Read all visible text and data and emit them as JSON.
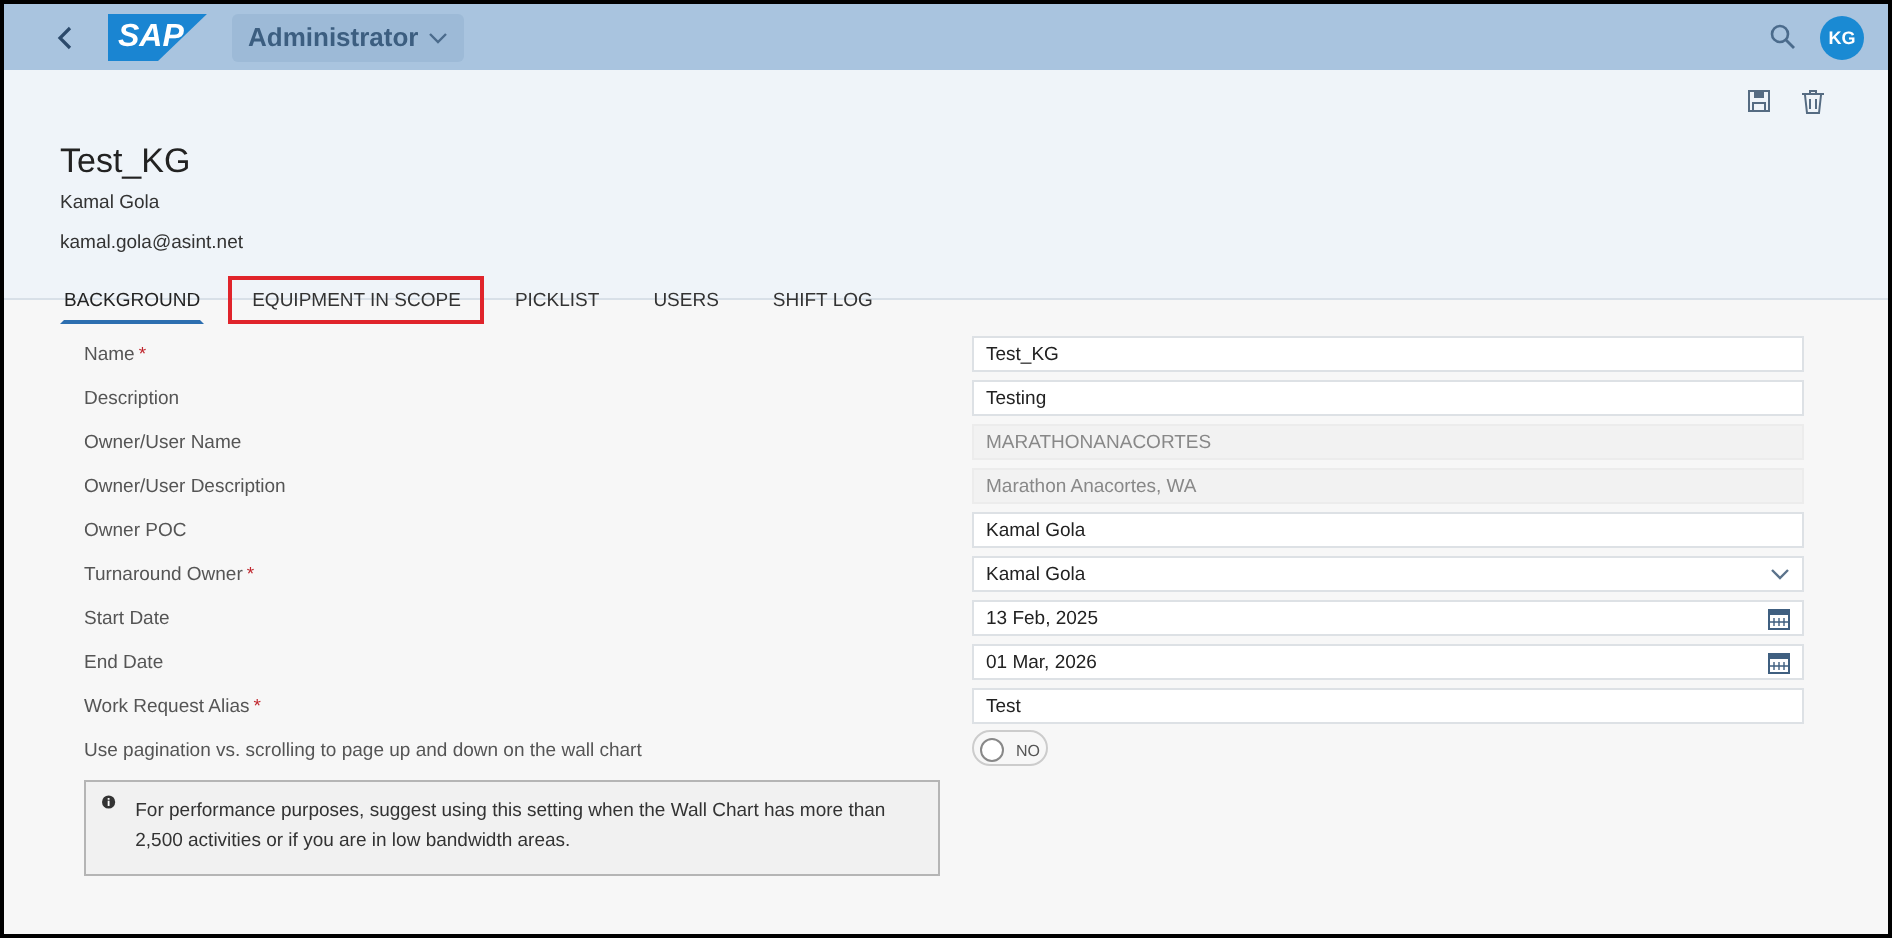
{
  "shell": {
    "logo": "SAP",
    "role": "Administrator",
    "avatar": "KG"
  },
  "header": {
    "title": "Test_KG",
    "subtitle": "Kamal Gola",
    "email": "kamal.gola@asint.net"
  },
  "tabs": [
    {
      "label": "BACKGROUND",
      "selected": true,
      "highlighted": false
    },
    {
      "label": "EQUIPMENT IN SCOPE",
      "selected": false,
      "highlighted": true
    },
    {
      "label": "PICKLIST",
      "selected": false,
      "highlighted": false
    },
    {
      "label": "USERS",
      "selected": false,
      "highlighted": false
    },
    {
      "label": "SHIFT LOG",
      "selected": false,
      "highlighted": false
    }
  ],
  "fields": [
    {
      "label": "Name",
      "required_mark": "*",
      "kind": "text",
      "value": "Test_KG"
    },
    {
      "label": "Description",
      "kind": "text",
      "value": "Testing"
    },
    {
      "label": "Owner/User Name",
      "kind": "readonly",
      "value": "MARATHONANACORTES"
    },
    {
      "label": "Owner/User Description",
      "kind": "readonly",
      "value": "Marathon Anacortes, WA"
    },
    {
      "label": "Owner POC",
      "kind": "text",
      "value": "Kamal Gola"
    },
    {
      "label": "Turnaround Owner",
      "required_mark": "*",
      "kind": "select",
      "value": "Kamal Gola"
    },
    {
      "label": "Start Date",
      "kind": "date",
      "value": "13 Feb, 2025"
    },
    {
      "label": "End Date",
      "kind": "date",
      "value": "01 Mar, 2026"
    },
    {
      "label": "Work Request Alias",
      "required_mark": "*",
      "kind": "text",
      "value": "Test"
    }
  ],
  "pagination": {
    "label": "Use pagination vs. scrolling to page up and down on the wall chart",
    "on": false,
    "switch_text": "NO"
  },
  "info": "For performance purposes, suggest using this setting when the Wall Chart has more than 2,500 activities or if you are in low bandwidth areas."
}
